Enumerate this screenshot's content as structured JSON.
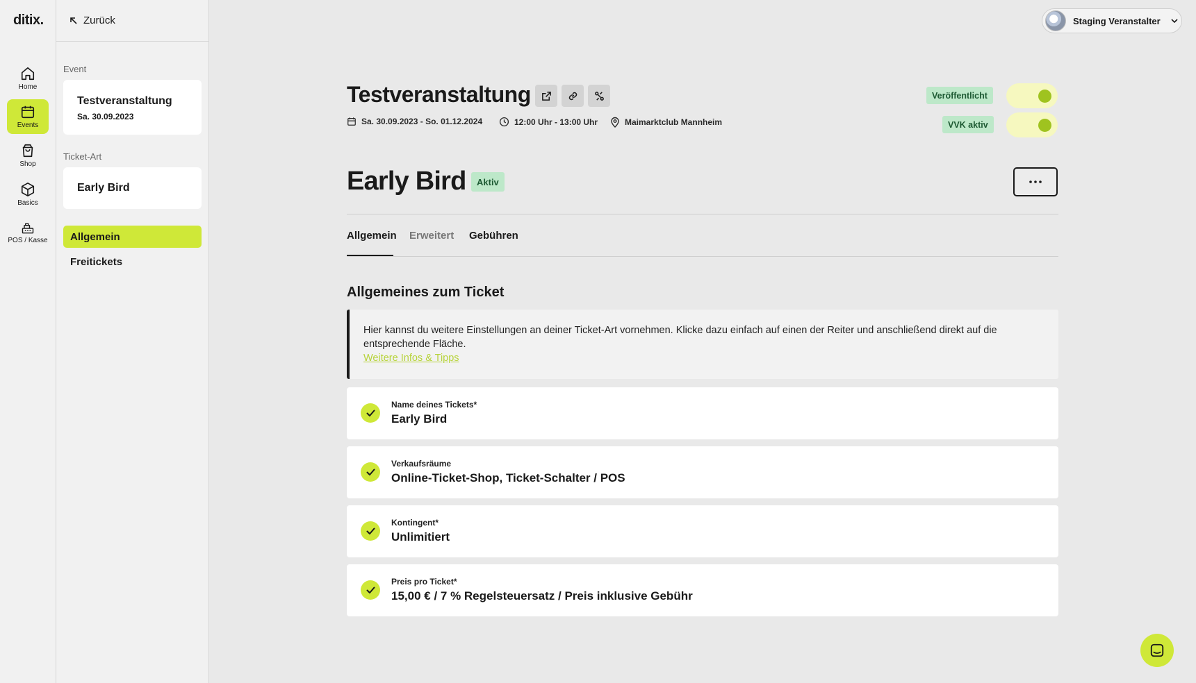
{
  "app": {
    "logo": "ditix."
  },
  "rail": {
    "items": [
      {
        "label": "Home",
        "icon": "home-icon"
      },
      {
        "label": "Events",
        "icon": "calendar-icon"
      },
      {
        "label": "Shop",
        "icon": "shopping-bag-icon"
      },
      {
        "label": "Basics",
        "icon": "box-icon"
      },
      {
        "label": "POS / Kasse",
        "icon": "cash-register-icon"
      }
    ],
    "active": "Events"
  },
  "sidebar": {
    "back_label": "Zurück",
    "event_section": "Event",
    "event_name": "Testveranstaltung",
    "event_date": "Sa. 30.09.2023",
    "ticket_section": "Ticket-Art",
    "ticket_name": "Early Bird",
    "nav": [
      {
        "label": "Allgemein",
        "active": true
      },
      {
        "label": "Freitickets",
        "active": false
      }
    ]
  },
  "header": {
    "organizer": "Staging Veranstalter"
  },
  "event": {
    "title": "Testveranstaltung",
    "date_range": "Sa. 30.09.2023 - So. 01.12.2024",
    "time_range": "12:00 Uhr - 13:00 Uhr",
    "location": "Maimarktclub Mannheim",
    "status_published": "Veröffentlicht",
    "status_presale": "VVK aktiv",
    "published_on": true,
    "presale_on": true
  },
  "ticket": {
    "title": "Early Bird",
    "status": "Aktiv"
  },
  "tabs": [
    {
      "label": "Allgemein",
      "active": true
    },
    {
      "label": "Erweitert",
      "active": false
    },
    {
      "label": "Gebühren",
      "active": false
    }
  ],
  "section": {
    "title": "Allgemeines zum Ticket",
    "info_text": "Hier kannst du weitere Einstellungen an deiner Ticket-Art vornehmen. Klicke dazu einfach auf einen der Reiter und anschließend direkt auf die entsprechende Fläche.",
    "info_link": "Weitere Infos & Tipps"
  },
  "fields": [
    {
      "label": "Name deines Tickets*",
      "value": "Early Bird"
    },
    {
      "label": "Verkaufsräume",
      "value": "Online-Ticket-Shop, Ticket-Schalter / POS"
    },
    {
      "label": "Kontingent*",
      "value": "Unlimitiert"
    },
    {
      "label": "Preis pro Ticket*",
      "value": "15,00 € / 7 % Regelsteuersatz / Preis inklusive Gebühr"
    }
  ],
  "colors": {
    "accent": "#cfe838",
    "status_bg": "#bde8c9",
    "status_text": "#1d5a33",
    "toggle_bg": "#f6f8bf"
  }
}
